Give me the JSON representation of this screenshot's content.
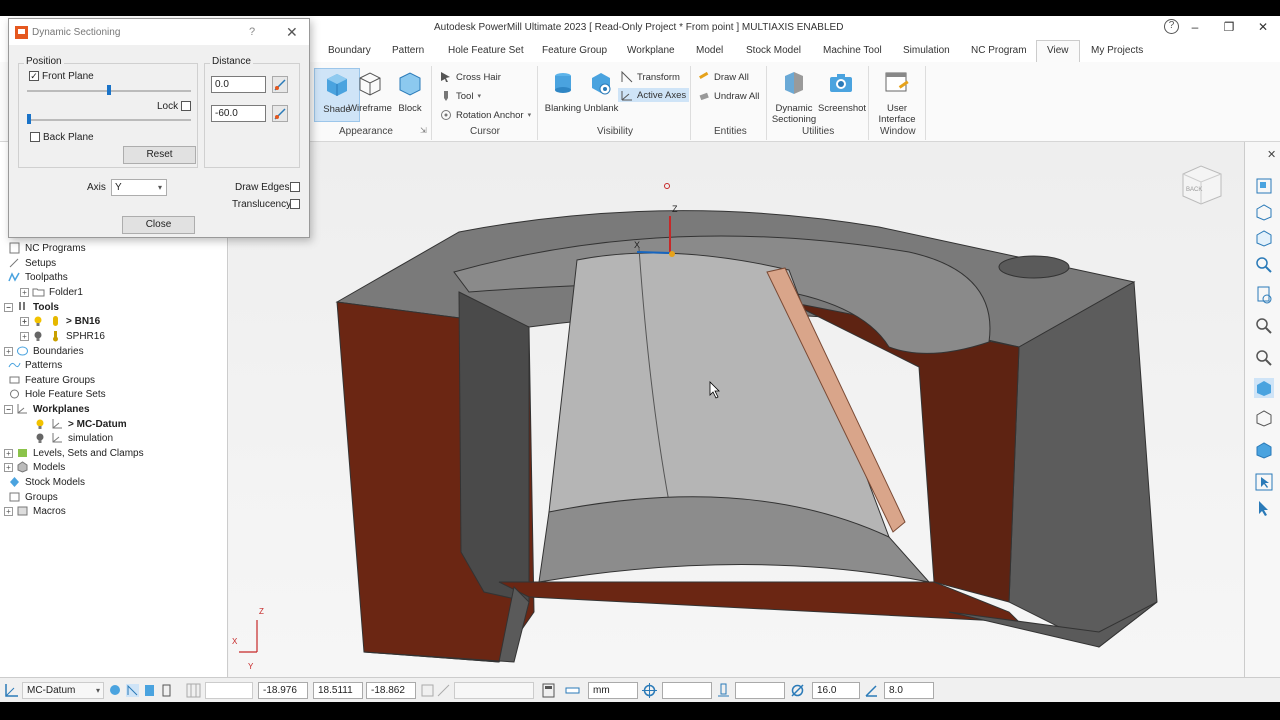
{
  "app": {
    "title": "Autodesk PowerMill Ultimate 2023   [ Read-Only Project * From point ]   MULTIAXIS ENABLED",
    "help": "?",
    "win_min": "–",
    "win_restore": "❐",
    "win_close": "✕"
  },
  "tabs": [
    {
      "label": "Boundary"
    },
    {
      "label": "Pattern"
    },
    {
      "label": "Hole Feature Set"
    },
    {
      "label": "Feature Group"
    },
    {
      "label": "Workplane"
    },
    {
      "label": "Model"
    },
    {
      "label": "Stock Model"
    },
    {
      "label": "Machine Tool"
    },
    {
      "label": "Simulation"
    },
    {
      "label": "NC Program"
    },
    {
      "label": "View"
    },
    {
      "label": "My Projects"
    }
  ],
  "ribbon": {
    "appearance": {
      "label": "Appearance",
      "shade": "Shade",
      "wireframe": "Wireframe",
      "block": "Block"
    },
    "cursor": {
      "label": "Cursor",
      "cross_hair": "Cross Hair",
      "tool": "Tool",
      "rotation_anchor": "Rotation Anchor"
    },
    "visibility": {
      "label": "Visibility",
      "blanking": "Blanking",
      "unblank": "Unblank",
      "transform": "Transform",
      "active_axes": "Active Axes"
    },
    "entities": {
      "label": "Entities",
      "draw_all": "Draw All",
      "undraw_all": "Undraw All"
    },
    "utilities": {
      "label": "Utilities",
      "dynamic_sectioning": "Dynamic",
      "dynamic_sectioning_2": "Sectioning",
      "screenshot": "Screenshot"
    },
    "window": {
      "label": "Window",
      "user_interface": "User",
      "user_interface_2": "Interface"
    }
  },
  "tree": {
    "items": [
      {
        "label": "NC Programs"
      },
      {
        "label": "Setups"
      },
      {
        "label": "Toolpaths"
      },
      {
        "label": "Folder1"
      },
      {
        "label": "Tools"
      },
      {
        "label": "> BN16"
      },
      {
        "label": "SPHR16"
      },
      {
        "label": "Boundaries"
      },
      {
        "label": "Patterns"
      },
      {
        "label": "Feature Groups"
      },
      {
        "label": "Hole Feature Sets"
      },
      {
        "label": "Workplanes"
      },
      {
        "label": "> MC-Datum"
      },
      {
        "label": "simulation"
      },
      {
        "label": "Levels, Sets and Clamps"
      },
      {
        "label": "Models"
      },
      {
        "label": "Stock Models"
      },
      {
        "label": "Groups"
      },
      {
        "label": "Macros"
      }
    ]
  },
  "dialog": {
    "title": "Dynamic Sectioning",
    "help": "?",
    "close_x": "✕",
    "position_label": "Position",
    "front_plane": "Front Plane",
    "front_plane_check": "✓",
    "lock": "Lock",
    "back_plane": "Back Plane",
    "reset": "Reset",
    "distance_label": "Distance",
    "front_distance": "0.0",
    "back_distance": "-60.0",
    "axis_label": "Axis",
    "axis_value": "Y",
    "draw_edges": "Draw Edges",
    "translucency": "Translucency",
    "close": "Close",
    "front_slider_level": 0.5,
    "back_slider_level": 0.0
  },
  "viewport": {
    "cube_label": "BACK",
    "axis_z": "Z",
    "axis_x": "X",
    "triad_z": "Z",
    "triad_x": "X",
    "triad_y": "Y"
  },
  "statusbar": {
    "workplane": "MC-Datum",
    "x": "-18.976",
    "y": "18.5111",
    "z": "-18.862",
    "units": "mm",
    "tool_diameter": "16.0",
    "tool_value2": "8.0"
  },
  "colors": {
    "accent": "#1a73c8",
    "section_red": "#6b2613",
    "model_gray": "#6e6e6e"
  }
}
